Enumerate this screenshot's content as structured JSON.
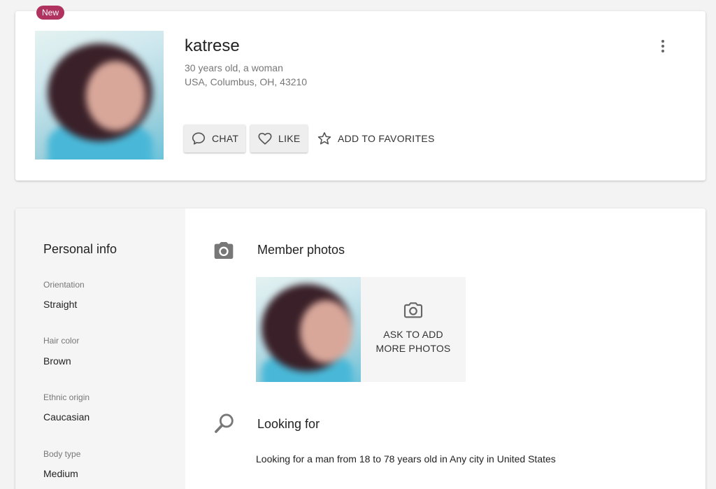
{
  "profile": {
    "badge": "New",
    "username": "katrese",
    "age_gender": "30 years old, a woman",
    "location": "USA, Columbus, OH, 43210",
    "actions": {
      "chat": "CHAT",
      "like": "LIKE",
      "favorites": "ADD TO FAVORITES"
    },
    "icons": [
      "chat-bubble-icon",
      "heart-icon",
      "star-icon",
      "more-vert-icon"
    ]
  },
  "personal_info": {
    "title": "Personal info",
    "items": [
      {
        "label": "Orientation",
        "value": "Straight"
      },
      {
        "label": "Hair color",
        "value": "Brown"
      },
      {
        "label": "Ethnic origin",
        "value": "Caucasian"
      },
      {
        "label": "Body type",
        "value": "Medium"
      }
    ]
  },
  "member_photos": {
    "title": "Member photos",
    "ask_more": "ASK TO ADD MORE PHOTOS",
    "icons": [
      "camera-icon"
    ]
  },
  "looking_for": {
    "title": "Looking for",
    "text": "Looking for a man from 18 to 78 years old in Any city in United States",
    "icons": [
      "search-icon"
    ]
  },
  "colors": {
    "badge": "#b0335f",
    "background": "#f3f3f3",
    "sidebar": "#f5f5f5",
    "button": "#eeeeee"
  }
}
